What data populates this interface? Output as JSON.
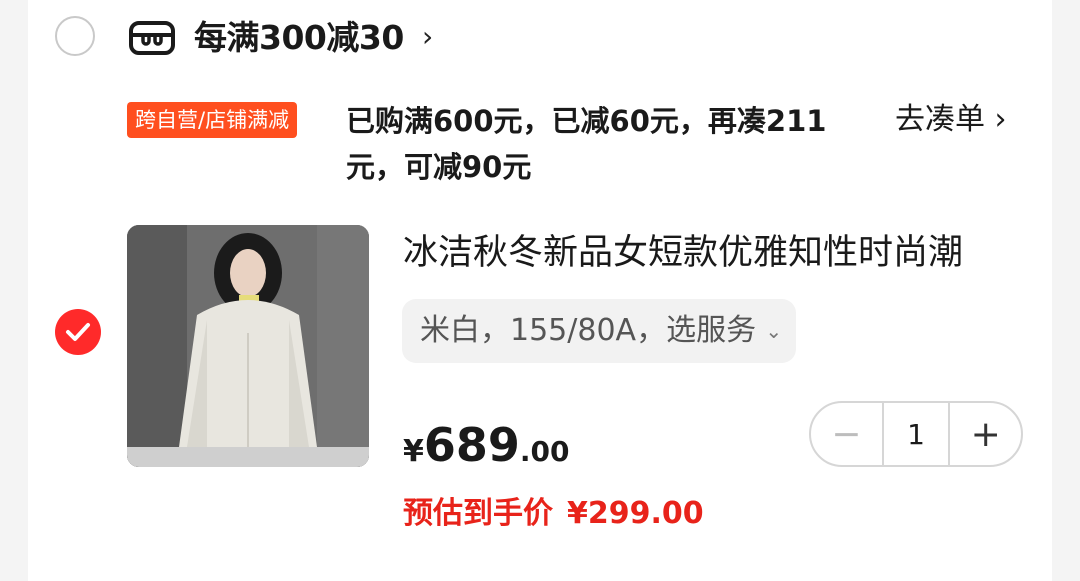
{
  "shop": {
    "promo_title": "每满300减30",
    "chevron": "›",
    "store_icon": "store-icon"
  },
  "promo": {
    "tag": "跨自营/店铺满减",
    "description": "已购满600元，已减60元，再凑211元，可减90元",
    "action": "去凑单 ›"
  },
  "item": {
    "title": "冰洁秋冬新品女短款优雅知性时尚潮",
    "sku": "米白，155/80A，选服务",
    "sku_chevron": "⌄",
    "price_currency": "¥",
    "price_int": "689",
    "price_dec": ".00",
    "quantity": "1",
    "minus": "−",
    "plus": "+",
    "est_label": "预估到手价",
    "est_price": "¥299.00",
    "image_desc": "woman in white puffer jacket"
  },
  "colors": {
    "accent_red": "#e8231a",
    "tag_orange": "#ff4f1f",
    "check_red": "#ff2a2a"
  }
}
